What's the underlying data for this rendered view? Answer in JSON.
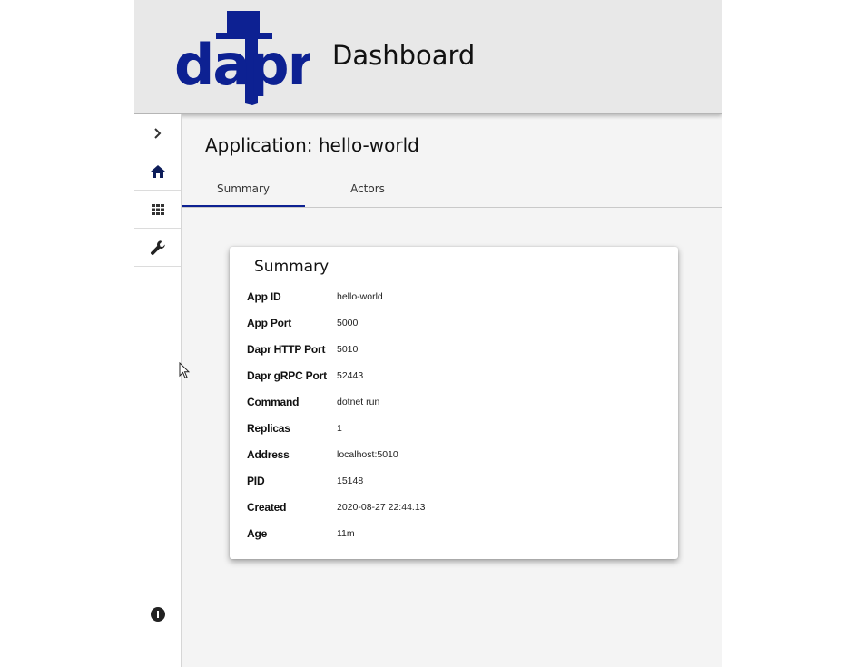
{
  "header": {
    "logo_text": "dapr",
    "title": "Dashboard",
    "brand_color": "#0d2192"
  },
  "sidebar": {
    "items": [
      {
        "icon": "chevron-right-icon"
      },
      {
        "icon": "home-icon"
      },
      {
        "icon": "grid-icon"
      },
      {
        "icon": "wrench-icon"
      }
    ],
    "footer_icon": "info-icon"
  },
  "main": {
    "title": "Application: hello-world",
    "tabs": [
      {
        "label": "Summary",
        "active": true
      },
      {
        "label": "Actors",
        "active": false
      }
    ],
    "summary": {
      "title": "Summary",
      "rows": [
        {
          "key": "App ID",
          "value": "hello-world"
        },
        {
          "key": "App Port",
          "value": "5000"
        },
        {
          "key": "Dapr HTTP Port",
          "value": "5010"
        },
        {
          "key": "Dapr gRPC Port",
          "value": "52443"
        },
        {
          "key": "Command",
          "value": "dotnet run"
        },
        {
          "key": "Replicas",
          "value": "1"
        },
        {
          "key": "Address",
          "value": "localhost:5010"
        },
        {
          "key": "PID",
          "value": "15148"
        },
        {
          "key": "Created",
          "value": "2020-08-27 22:44.13"
        },
        {
          "key": "Age",
          "value": "11m"
        }
      ]
    }
  }
}
